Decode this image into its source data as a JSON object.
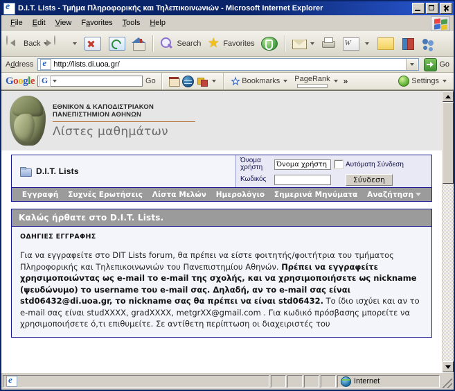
{
  "window": {
    "title": "D.I.T. Lists - Τμήμα Πληροφορικής και Τηλεπικοινωνιών - Microsoft Internet Explorer",
    "icon": "ie-icon",
    "minimize_label": "Minimize",
    "maximize_label": "Maximize",
    "close_label": "Close"
  },
  "menu": {
    "items": [
      {
        "label": "File",
        "accel": "F"
      },
      {
        "label": "Edit",
        "accel": "E"
      },
      {
        "label": "View",
        "accel": "V"
      },
      {
        "label": "Favorites",
        "accel": "a"
      },
      {
        "label": "Tools",
        "accel": "T"
      },
      {
        "label": "Help",
        "accel": "H"
      }
    ]
  },
  "toolbar": {
    "back_label": "Back",
    "search_label": "Search",
    "favorites_label": "Favorites",
    "icons": [
      "back-icon",
      "forward-icon",
      "stop-icon",
      "refresh-icon",
      "home-icon",
      "search-icon",
      "favorites-star-icon",
      "history-icon",
      "mail-icon",
      "print-icon",
      "edit-word-icon",
      "notes-icon",
      "research-icon",
      "messenger-icon"
    ]
  },
  "address": {
    "label": "Address",
    "url": "http://lists.di.uoa.gr/",
    "go_label": "Go"
  },
  "google_toolbar": {
    "logo_letters": [
      "G",
      "o",
      "o",
      "g",
      "l",
      "e"
    ],
    "search_value": "",
    "search_placeholder": "",
    "g_badge": "G",
    "go_label": "Go",
    "bookmarks_label": "Bookmarks",
    "pagerank_label": "PageRank",
    "more_label": "»",
    "settings_label": "Settings"
  },
  "page": {
    "banner": {
      "university_line1": "ΕΘΝΙΚΟΝ & ΚΑΠΟΔΙΣΤΡΙΑΚΟΝ",
      "university_line2": "ΠΑΝΕΠΙΣΤΗΜΙΟΝ ΑΘΗΝΩΝ",
      "subtitle": "Λίστες μαθημάτων",
      "logo_name": "athena-head-logo"
    },
    "forum": {
      "title": "D.I.T. Lists",
      "login": {
        "username_label": "Όνομα χρήστη",
        "username_value": "Όνομα χρήστη",
        "password_label": "Κωδικός",
        "password_value": "",
        "autologin_label": "Αυτόματη Σύνδεση",
        "autologin_checked": false,
        "submit_label": "Σύνδεση"
      },
      "nav": [
        {
          "label": "Εγγραφή",
          "caret": false
        },
        {
          "label": "Συχνές Ερωτήσεις",
          "caret": false
        },
        {
          "label": "Λίστα Μελών",
          "caret": false
        },
        {
          "label": "Ημερολόγιο",
          "caret": false
        },
        {
          "label": "Σημερινά Μηνύματα",
          "caret": false
        },
        {
          "label": "Αναζήτηση",
          "caret": true
        }
      ],
      "panel": {
        "header": "Καλώς ήρθατε στο D.I.T. Lists.",
        "subheader": "ΟΔΗΓΙΕΣ ΕΓΓΡΑΦΗΣ",
        "text_1": "Για να εγγραφείτε στο DIT Lists forum, θα πρέπει να είστε φοιτητής/φοιτήτρια του τμήματος Πληροφορικής και Τηλεπικοινωνιών του Πανεπιστημίου Αθηνών. ",
        "text_bold_1": "Πρέπει να εγγραφείτε χρησιμοποιώντας ως e-mail το e-mail της σχολής, και να χρησιμοποιήσετε ως nickname (ψευδώνυμο) το username του e-mail σας. Δηλαδή, αν το e-mail σας είναι std06432@di.uoa.gr, το nickname σας θα πρέπει να είναι std06432.",
        "text_2": " Το ίδιο ισχύει και αν το e-mail σας είναι studXXXX, gradXXXX, metgrXX@gmail.com . Για κωδικό πρόσβασης μπορείτε να χρησιμοποιήσετε ό,τι επιθυμείτε. Σε αντίθετη περίπτωση οι διαχειριστές του"
      }
    }
  },
  "scrollbar": {
    "up_label": "Scroll up",
    "down_label": "Scroll down"
  },
  "status": {
    "message": "",
    "zone": "Internet"
  }
}
